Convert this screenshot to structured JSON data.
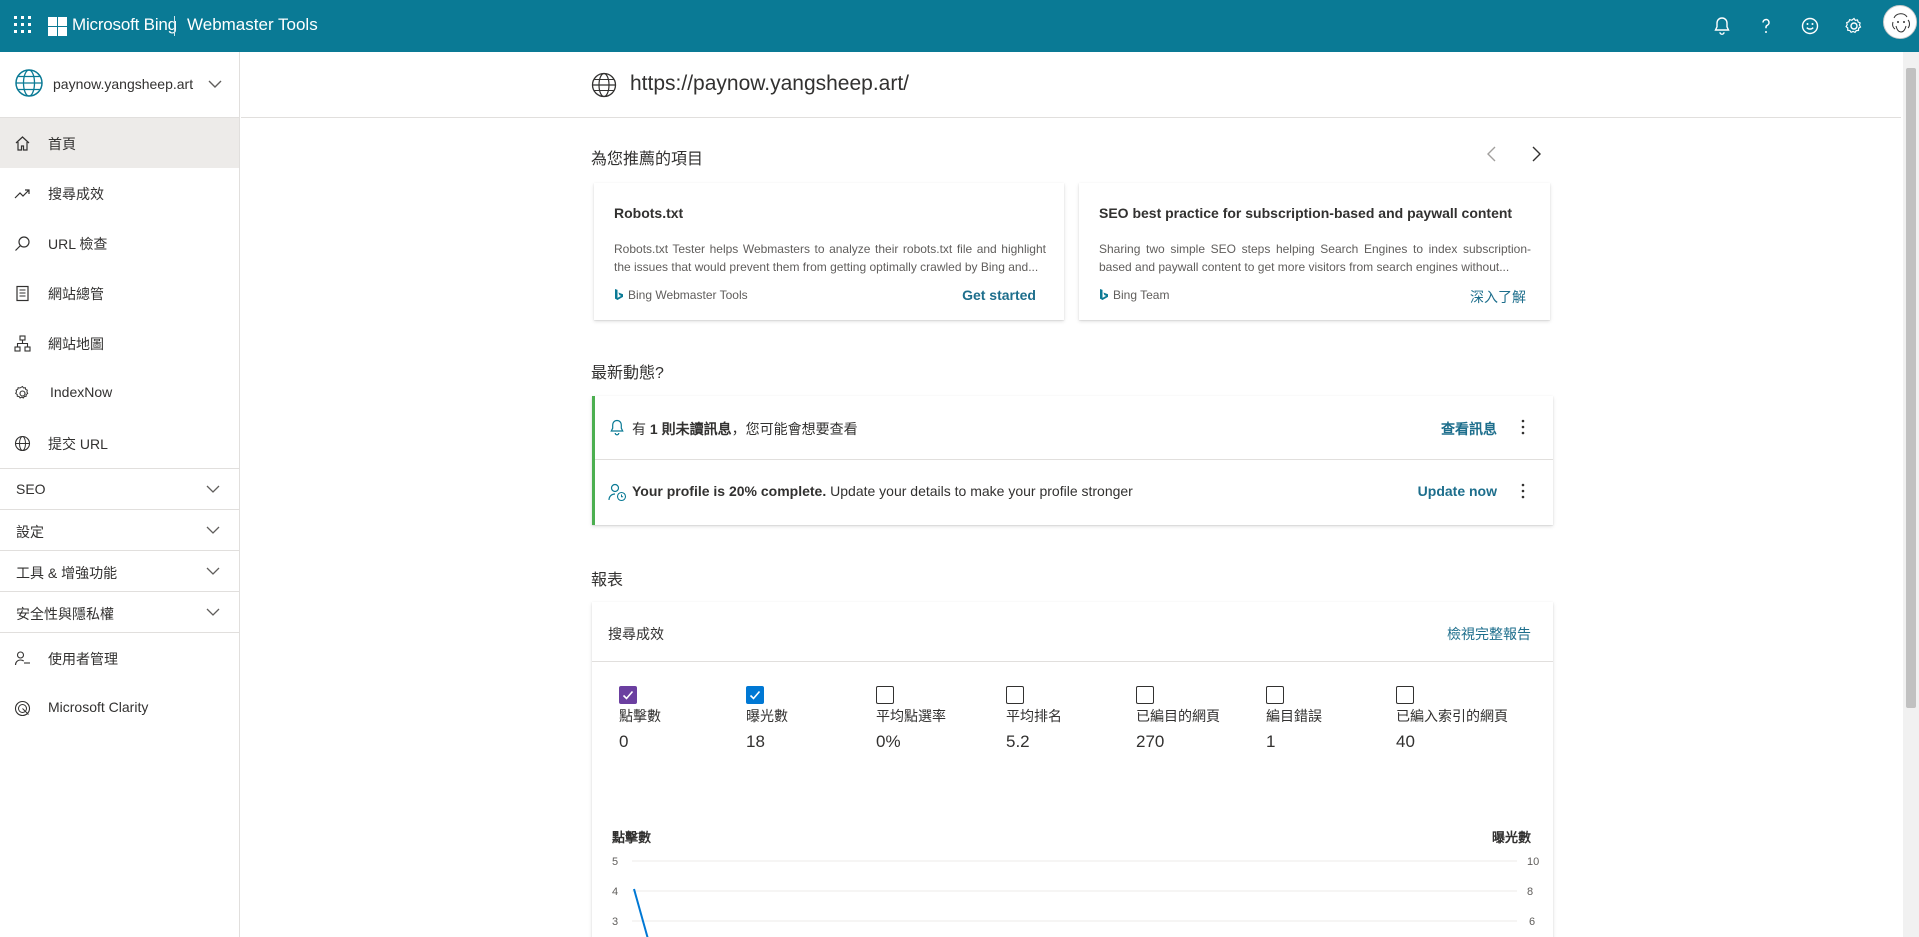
{
  "header": {
    "brand": "Microsoft Bing",
    "product": "Webmaster Tools",
    "icons": [
      "bell-icon",
      "help-icon",
      "feedback-smiley-icon",
      "settings-gear-icon"
    ]
  },
  "sidebar": {
    "site_name": "paynow.yangsheep.art",
    "items": [
      {
        "label": "首頁",
        "icon": "home-icon"
      },
      {
        "label": "搜尋成效",
        "icon": "trend-icon"
      },
      {
        "label": "URL 檢查",
        "icon": "search-icon"
      },
      {
        "label": "網站總管",
        "icon": "document-icon"
      },
      {
        "label": "網站地圖",
        "icon": "sitemap-icon"
      },
      {
        "label": "IndexNow",
        "icon": "gear-icon"
      },
      {
        "label": "提交 URL",
        "icon": "globe-icon"
      }
    ],
    "groups": [
      "SEO",
      "設定",
      "工具 & 增強功能",
      "安全性與隱私權"
    ],
    "bottom_items": [
      {
        "label": "使用者管理",
        "icon": "user-icon"
      },
      {
        "label": "Microsoft Clarity",
        "icon": "clarity-icon"
      }
    ]
  },
  "main": {
    "site_url": "https://paynow.yangsheep.art/",
    "recommended_title": "為您推薦的項目",
    "recommendations": [
      {
        "title": "Robots.txt",
        "description": "Robots.txt Tester helps Webmasters to analyze their robots.txt file and highlight the issues that would prevent them from getting optimally crawled by Bing and...",
        "source": "Bing Webmaster Tools",
        "cta": "Get started"
      },
      {
        "title": "SEO best practice for subscription-based and paywall content",
        "description": "Sharing two simple SEO steps helping Search Engines to index subscription-based and paywall content to get more visitors from search engines without...",
        "source": "Bing Team",
        "cta": "深入了解"
      }
    ],
    "activity_title": "最新動態?",
    "activity": {
      "row1_pre": "有 ",
      "row1_bold": "1 則未讀訊息",
      "row1_post": "，您可能會想要查看",
      "row1_action": "查看訊息",
      "row2_bold": "Your profile is 20% complete.",
      "row2_post": " Update your details to make your profile stronger",
      "row2_action": "Update now"
    },
    "reports_title": "報表",
    "report": {
      "name": "搜尋成效",
      "link": "檢視完整報告",
      "metrics": [
        {
          "label": "點擊數",
          "value": "0",
          "checked": true,
          "color": "#6b3fa0"
        },
        {
          "label": "曝光數",
          "value": "18",
          "checked": true,
          "color": "#0078d4"
        },
        {
          "label": "平均點選率",
          "value": "0%",
          "checked": false
        },
        {
          "label": "平均排名",
          "value": "5.2",
          "checked": false
        },
        {
          "label": "已編目的網頁",
          "value": "270",
          "checked": false
        },
        {
          "label": "編目錯誤",
          "value": "1",
          "checked": false
        },
        {
          "label": "已編入索引的網頁",
          "value": "40",
          "checked": false
        }
      ],
      "chart_left_label": "點擊數",
      "chart_right_label": "曝光數",
      "left_ticks": [
        "5",
        "4",
        "3"
      ],
      "right_ticks": [
        "10",
        "8",
        "6"
      ]
    }
  }
}
